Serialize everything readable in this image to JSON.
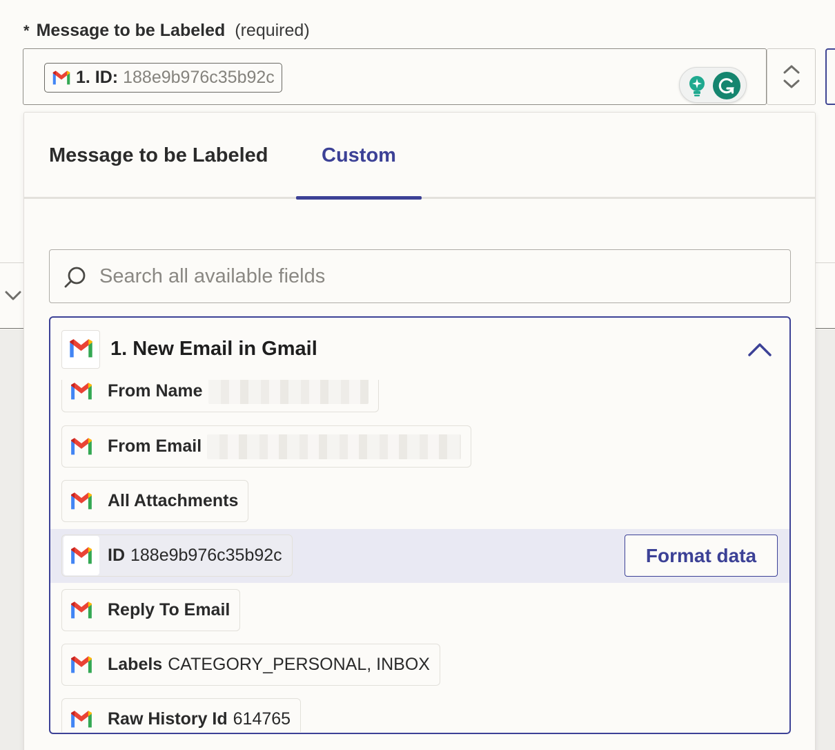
{
  "field": {
    "required_marker": "*",
    "label": "Message to be Labeled",
    "required_text": "(required)",
    "pill_key": "1. ID:",
    "pill_value": "188e9b976c35b92c"
  },
  "tabs": [
    {
      "label": "Message to be Labeled",
      "active": false
    },
    {
      "label": "Custom",
      "active": true
    }
  ],
  "search": {
    "placeholder": "Search all available fields",
    "value": ""
  },
  "group": {
    "title": "1. New Email in Gmail",
    "expanded": true
  },
  "items": [
    {
      "key": "From Name",
      "value": "",
      "redacted": true
    },
    {
      "key": "From Email",
      "value": "",
      "redacted": true
    },
    {
      "key": "All Attachments",
      "value": ""
    },
    {
      "key": "ID",
      "value": "188e9b976c35b92c",
      "highlighted": true
    },
    {
      "key": "Reply To Email",
      "value": ""
    },
    {
      "key": "Labels",
      "value": "CATEGORY_PERSONAL, INBOX"
    },
    {
      "key": "Raw History Id",
      "value": "614765"
    }
  ],
  "format_button": "Format data",
  "colors": {
    "accent": "#3c4196",
    "highlight_row": "#e9e9f3",
    "grammarly": "#15856f",
    "gmail_red": "#ea4335",
    "gmail_blue": "#4285f4",
    "gmail_green": "#34a853",
    "gmail_yellow": "#fbbc04"
  },
  "icons": [
    "gmail-icon",
    "grammarly-bulb-icon",
    "grammarly-g-icon",
    "stepper-icon",
    "search-icon",
    "chevron-up-icon",
    "chevron-down-icon"
  ]
}
